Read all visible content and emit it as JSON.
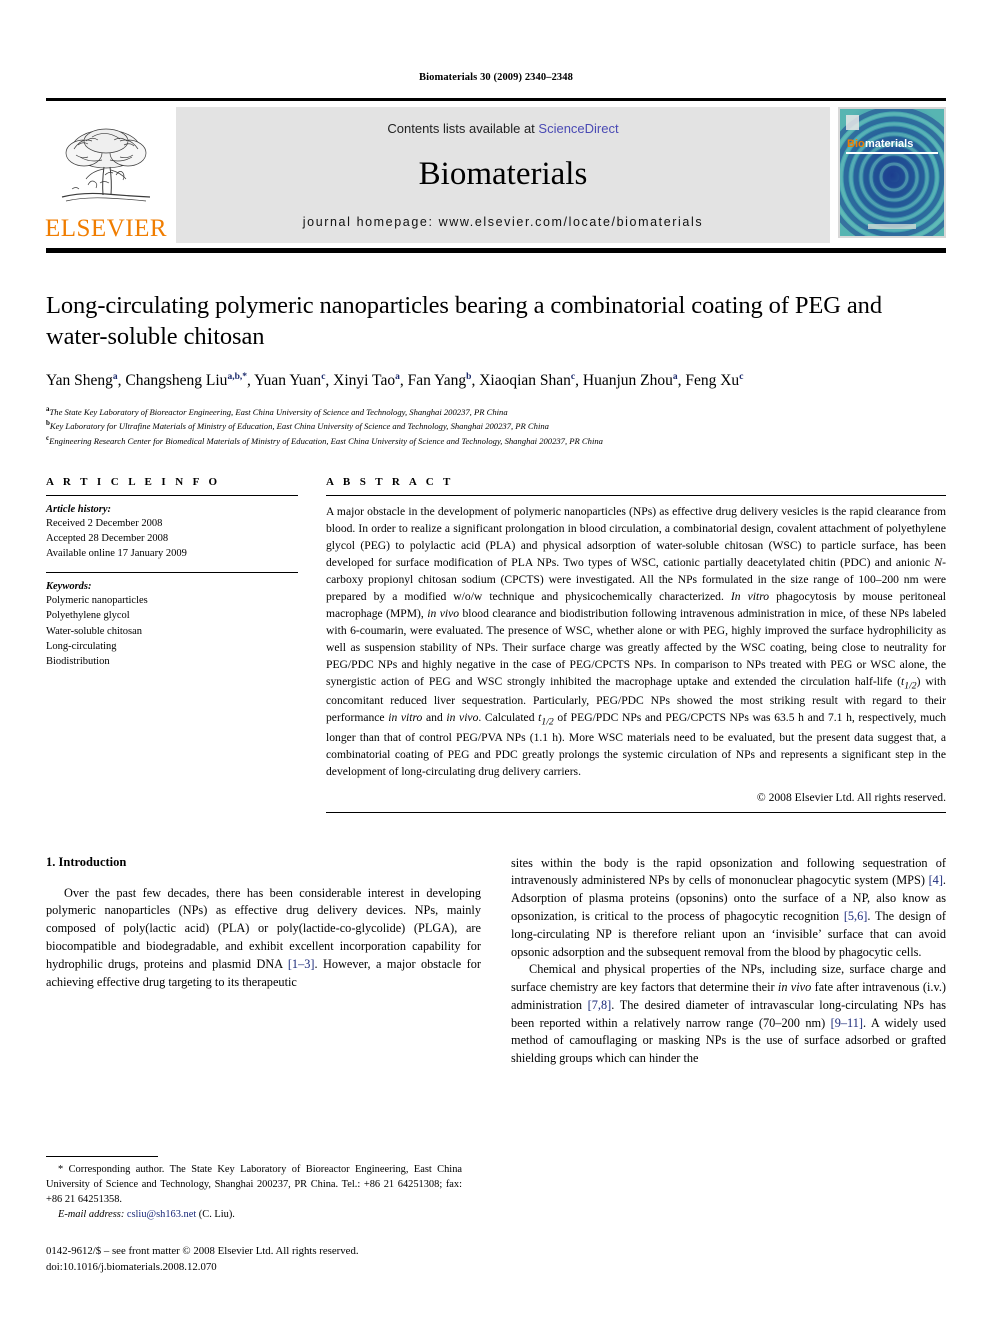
{
  "running_head": "Biomaterials 30 (2009) 2340–2348",
  "masthead": {
    "publisher_name": "ELSEVIER",
    "contents_prefix": "Contents lists available at ",
    "contents_link": "ScienceDirect",
    "journal_title": "Biomaterials",
    "homepage": "journal homepage: www.elsevier.com/locate/biomaterials",
    "cover_title_a": "Bio",
    "cover_title_b": "materials",
    "link_color": "#4a4ab4",
    "brand_color": "#f07d00"
  },
  "article": {
    "title": "Long-circulating polymeric nanoparticles bearing a combinatorial coating of PEG and water-soluble chitosan",
    "authors": [
      {
        "name": "Yan Sheng",
        "sup": "a",
        "sep": ", "
      },
      {
        "name": "Changsheng Liu",
        "sup": "a,b,*",
        "sep": ", "
      },
      {
        "name": "Yuan Yuan",
        "sup": "c",
        "sep": ", "
      },
      {
        "name": "Xinyi Tao",
        "sup": "a",
        "sep": ", "
      },
      {
        "name": "Fan Yang",
        "sup": "b",
        "sep": ", "
      },
      {
        "name": "Xiaoqian Shan",
        "sup": "c",
        "sep": ", "
      },
      {
        "name": "Huanjun Zhou",
        "sup": "a",
        "sep": ", "
      },
      {
        "name": "Feng Xu",
        "sup": "c",
        "sep": ""
      }
    ],
    "affiliations": [
      {
        "sup": "a",
        "text": "The State Key Laboratory of Bioreactor Engineering, East China University of Science and Technology, Shanghai 200237, PR China"
      },
      {
        "sup": "b",
        "text": "Key Laboratory for Ultrafine Materials of Ministry of Education, East China University of Science and Technology, Shanghai 200237, PR China"
      },
      {
        "sup": "c",
        "text": "Engineering Research Center for Biomedical Materials of Ministry of Education, East China University of Science and Technology, Shanghai 200237, PR China"
      }
    ]
  },
  "article_info": {
    "label": "A R T I C L E   I N F O",
    "history_head": "Article history:",
    "history": [
      "Received 2 December 2008",
      "Accepted 28 December 2008",
      "Available online 17 January 2009"
    ],
    "keywords_head": "Keywords:",
    "keywords": [
      "Polymeric nanoparticles",
      "Polyethylene glycol",
      "Water-soluble chitosan",
      "Long-circulating",
      "Biodistribution"
    ]
  },
  "abstract": {
    "label": "A B S T R A C T",
    "copyright": "© 2008 Elsevier Ltd. All rights reserved."
  },
  "introduction": {
    "heading": "1. Introduction"
  },
  "footnote": {
    "corresponding": "* Corresponding author. The State Key Laboratory of Bioreactor Engineering, East China University of Science and Technology, Shanghai 200237, PR China. Tel.: +86 21 64251308; fax: +86 21 64251358.",
    "email_label": "E-mail address:",
    "email": "csliu@sh163.net",
    "email_suffix": " (C. Liu).",
    "issn_line": "0142-9612/$ – see front matter © 2008 Elsevier Ltd. All rights reserved.",
    "doi_line": "doi:10.1016/j.biomaterials.2008.12.070"
  }
}
